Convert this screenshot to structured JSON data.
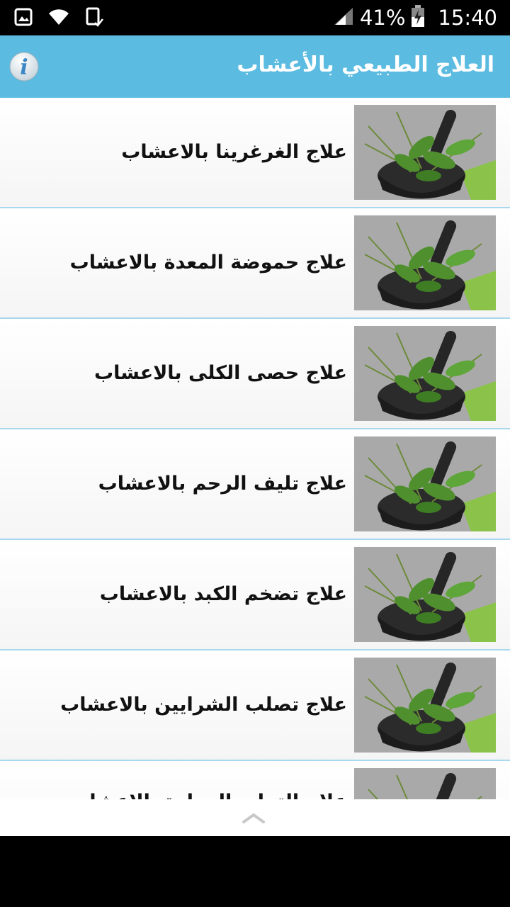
{
  "status_bar": {
    "battery_percent": "41%",
    "time": "15:40",
    "icons": [
      "gallery-icon",
      "wifi-icon",
      "device-sync-icon",
      "signal-icon",
      "battery-charging-icon"
    ]
  },
  "app_bar": {
    "title": "العلاج الطبيعي بالأعشاب",
    "background": "#5bbbe0",
    "info_icon": "info-icon"
  },
  "list": {
    "divider_color": "#a9d8ee",
    "items": [
      {
        "label": "علاج الغرغرينا بالاعشاب"
      },
      {
        "label": "علاج حموضة المعدة بالاعشاب"
      },
      {
        "label": "علاج حصى الكلى بالاعشاب"
      },
      {
        "label": "علاج تليف الرحم بالاعشاب"
      },
      {
        "label": "علاج تضخم الكبد بالاعشاب"
      },
      {
        "label": "علاج تصلب الشرايين بالاعشاب"
      },
      {
        "label": "علاج التهاب المرارة بالاعشاب"
      }
    ]
  },
  "footer": {
    "scroll_icon": "chevron-up-icon"
  }
}
